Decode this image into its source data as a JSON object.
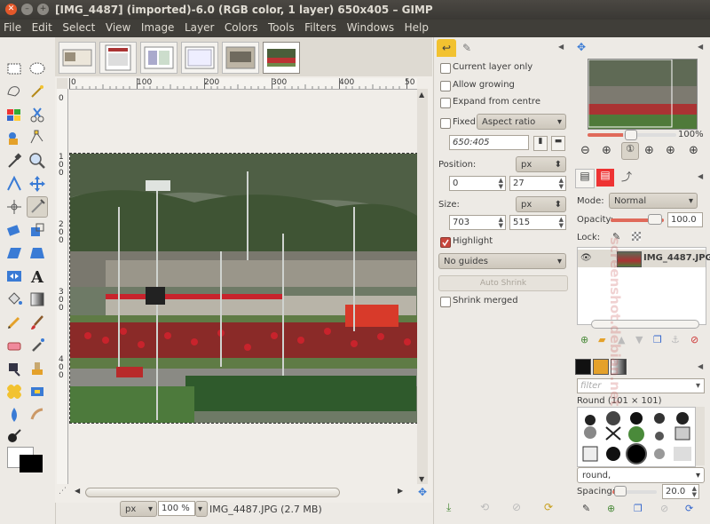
{
  "window": {
    "title": "[IMG_4487] (imported)-6.0 (RGB color, 1 layer) 650x405 – GIMP"
  },
  "menu": [
    "File",
    "Edit",
    "Select",
    "View",
    "Image",
    "Layer",
    "Colors",
    "Tools",
    "Filters",
    "Windows",
    "Help"
  ],
  "ruler": {
    "h_labels": [
      "0",
      "100",
      "200",
      "300",
      "400",
      "50"
    ],
    "v_labels": [
      "0",
      "1",
      "0",
      "0",
      "2",
      "0",
      "0",
      "3",
      "0",
      "0",
      "4",
      "0",
      "0"
    ]
  },
  "status": {
    "unit": "px",
    "zoom": "100 %",
    "file_info": "IMG_4487.JPG (2.7 MB)"
  },
  "tool_options": {
    "current_layer_only": "Current layer only",
    "allow_growing": "Allow growing",
    "expand_from_centre": "Expand from centre",
    "fixed_label": "Fixed:",
    "fixed_mode": "Aspect ratio",
    "ratio_value": "650:405",
    "position_label": "Position:",
    "position_unit": "px",
    "position_x": "0",
    "position_y": "27",
    "size_label": "Size:",
    "size_unit": "px",
    "size_w": "703",
    "size_h": "515",
    "highlight": "Highlight",
    "highlight_checked": true,
    "guides": "No guides",
    "auto_shrink": "Auto Shrink",
    "shrink_merged": "Shrink merged"
  },
  "navigator": {
    "zoom_percent": "100%"
  },
  "layers": {
    "mode_label": "Mode:",
    "mode_value": "Normal",
    "opacity_label": "Opacity:",
    "opacity_value": "100.0",
    "lock_label": "Lock:",
    "layer_name": "IMG_4487.JPG"
  },
  "brushes": {
    "filter_placeholder": "filter",
    "brush_title": "Round (101 × 101)",
    "brush_name": "round,",
    "spacing_label": "Spacing:",
    "spacing_value": "20.0"
  },
  "watermark": "screenshot.debian.net",
  "colors": {
    "accent": "#e4582a",
    "titlebar": "#3a3834",
    "panel": "#edeae5"
  }
}
